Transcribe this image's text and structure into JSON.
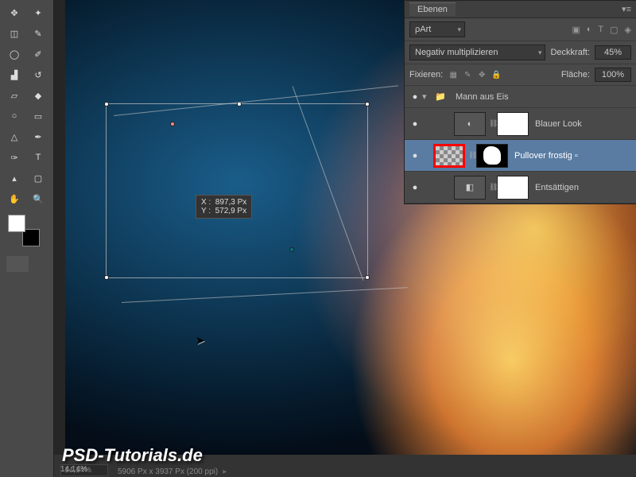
{
  "toolbox": {
    "tools": [
      "move",
      "magic-wand",
      "crop",
      "eyedropper",
      "lasso",
      "brush",
      "stamp",
      "history-brush",
      "eraser",
      "paint-bucket",
      "dodge",
      "gradient",
      "blur",
      "pen",
      "path",
      "type",
      "direct-select",
      "rectangle",
      "hand",
      "zoom"
    ],
    "fg_color": "#ffffff",
    "bg_color": "#000000"
  },
  "layers_panel": {
    "title": "Ebenen",
    "filter_label": "Art",
    "blend_mode": "Negativ multiplizieren",
    "opacity_label": "Deckkraft:",
    "opacity_value": "45%",
    "fix_label": "Fixieren:",
    "fill_label": "Fläche:",
    "fill_value": "100%",
    "group_name": "Mann aus Eis",
    "layers": [
      {
        "name": "Blauer Look"
      },
      {
        "name": "Pullover frostig"
      },
      {
        "name": "Entsättigen"
      }
    ]
  },
  "canvas": {
    "coord_x_label": "X :",
    "coord_x_value": "897,3 Px",
    "coord_y_label": "Y :",
    "coord_y_value": "572,9 Px"
  },
  "statusbar": {
    "zoom_pct": "14,14%",
    "zoom_display": "14,14%",
    "doc_info": "5906 Px x 3937 Px (200 ppi)"
  },
  "watermark": "PSD-Tutorials.de"
}
